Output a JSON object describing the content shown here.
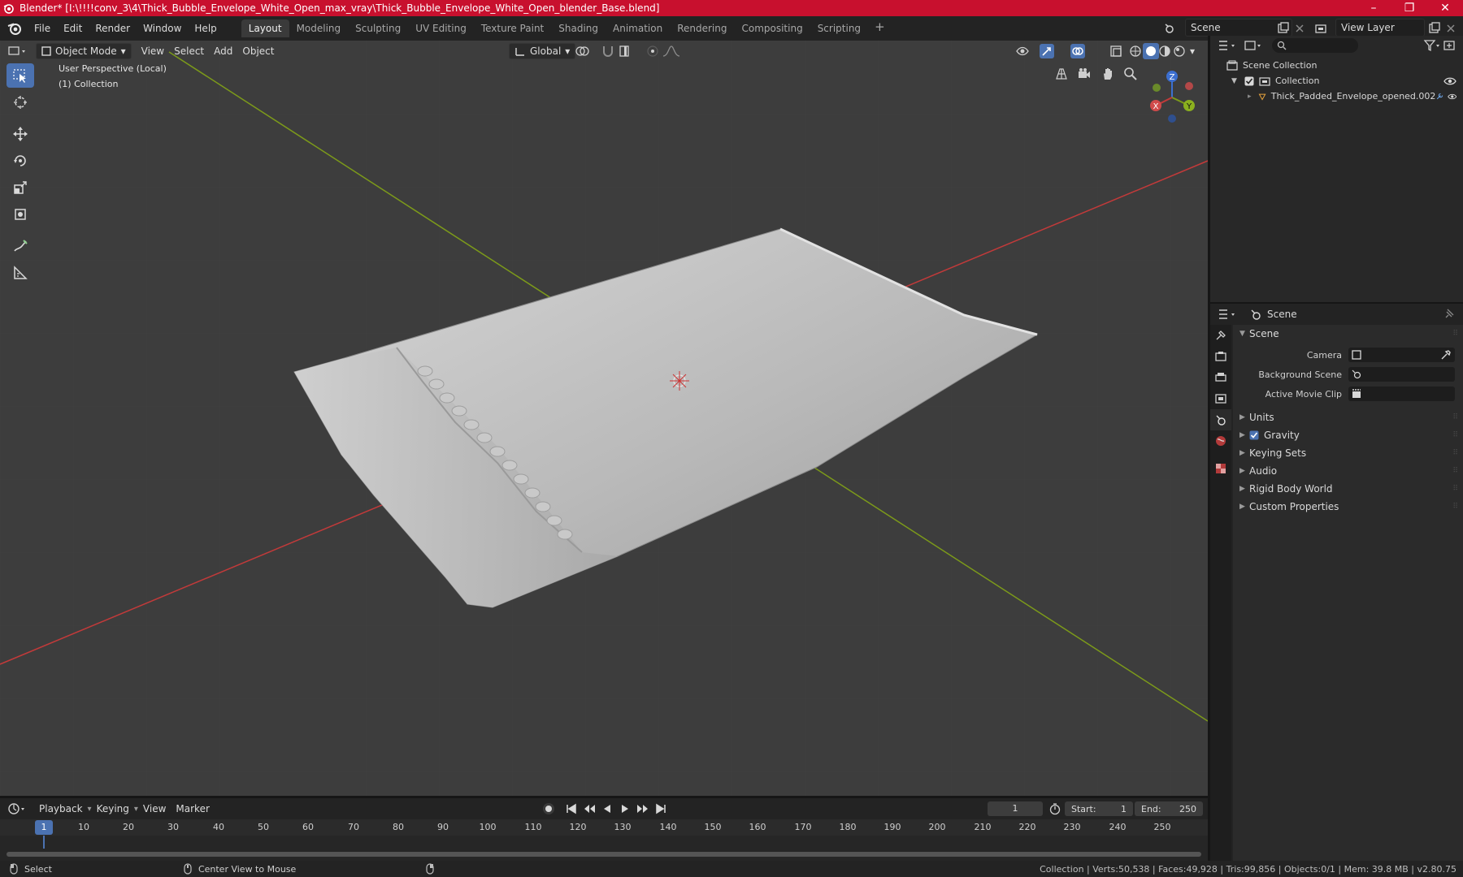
{
  "window": {
    "title": "Blender* [I:\\!!!!conv_3\\4\\Thick_Bubble_Envelope_White_Open_max_vray\\Thick_Bubble_Envelope_White_Open_blender_Base.blend]",
    "minimize": "–",
    "maximize": "❐",
    "close": "✕"
  },
  "menu": [
    "File",
    "Edit",
    "Render",
    "Window",
    "Help"
  ],
  "workspaces": [
    "Layout",
    "Modeling",
    "Sculpting",
    "UV Editing",
    "Texture Paint",
    "Shading",
    "Animation",
    "Rendering",
    "Compositing",
    "Scripting"
  ],
  "workspace_add": "+",
  "scene_selector": {
    "value": "Scene"
  },
  "view_layer_selector": {
    "value": "View Layer"
  },
  "viewport": {
    "mode": "Object Mode",
    "menus": [
      "View",
      "Select",
      "Add",
      "Object"
    ],
    "transform_orientation": "Global",
    "info_line1": "User Perspective (Local)",
    "info_line2": "(1) Collection",
    "gizmo": {
      "x": "X",
      "y": "Y",
      "z": "Z"
    }
  },
  "outliner": {
    "search_placeholder": "",
    "rows": {
      "scene_collection": "Scene Collection",
      "collection": "Collection",
      "object": "Thick_Padded_Envelope_opened.002"
    }
  },
  "properties": {
    "context": "Scene",
    "panel": "Scene",
    "fields": {
      "camera": "Camera",
      "background_scene": "Background Scene",
      "active_movie_clip": "Active Movie Clip"
    },
    "subpanels": {
      "units": "Units",
      "gravity": "Gravity",
      "keying_sets": "Keying Sets",
      "audio": "Audio",
      "rigid_body_world": "Rigid Body World",
      "custom_properties": "Custom Properties"
    },
    "gravity_checked": true
  },
  "timeline": {
    "menus": [
      "Playback",
      "Keying",
      "View",
      "Marker"
    ],
    "current_frame": "1",
    "start_label": "Start:",
    "start": "1",
    "end_label": "End:",
    "end": "250",
    "ticks": [
      "1",
      "10",
      "20",
      "30",
      "40",
      "50",
      "60",
      "70",
      "80",
      "90",
      "100",
      "110",
      "120",
      "130",
      "140",
      "150",
      "160",
      "170",
      "180",
      "190",
      "200",
      "210",
      "220",
      "230",
      "240",
      "250"
    ]
  },
  "status": {
    "select": "Select",
    "center": "Center View to Mouse",
    "stats": "Collection | Verts:50,538 | Faces:49,928 | Tris:99,856 | Objects:0/1 | Mem: 39.8 MB | v2.80.75"
  },
  "colors": {
    "titlebar": "#c8102e",
    "viewport_bg": "#3d3d3d",
    "accent": "#4b72b1",
    "axis_x": "#c23a3a",
    "axis_y": "#7c9a1a"
  }
}
